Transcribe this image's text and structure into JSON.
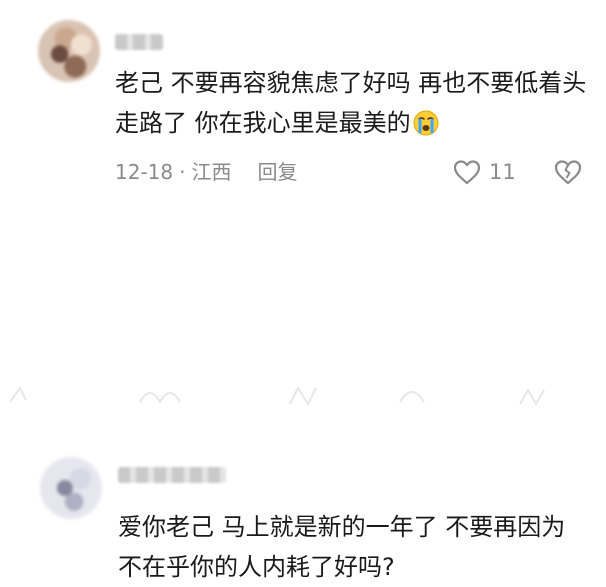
{
  "comments": [
    {
      "text": "老己 不要再容貌焦虑了好吗 再也不要低着头走路了 你在我心里是最美的",
      "emoji": "crying-face-icon",
      "date": "12-18",
      "separator": "·",
      "location": "江西",
      "reply_label": "回复",
      "like_count": "11"
    },
    {
      "text": "爱你老己 马上就是新的一年了 不要再因为不在乎你的人内耗了好吗?"
    }
  ],
  "colors": {
    "text": "#1a1a1a",
    "meta": "#8a8a8a",
    "background": "#ffffff"
  }
}
